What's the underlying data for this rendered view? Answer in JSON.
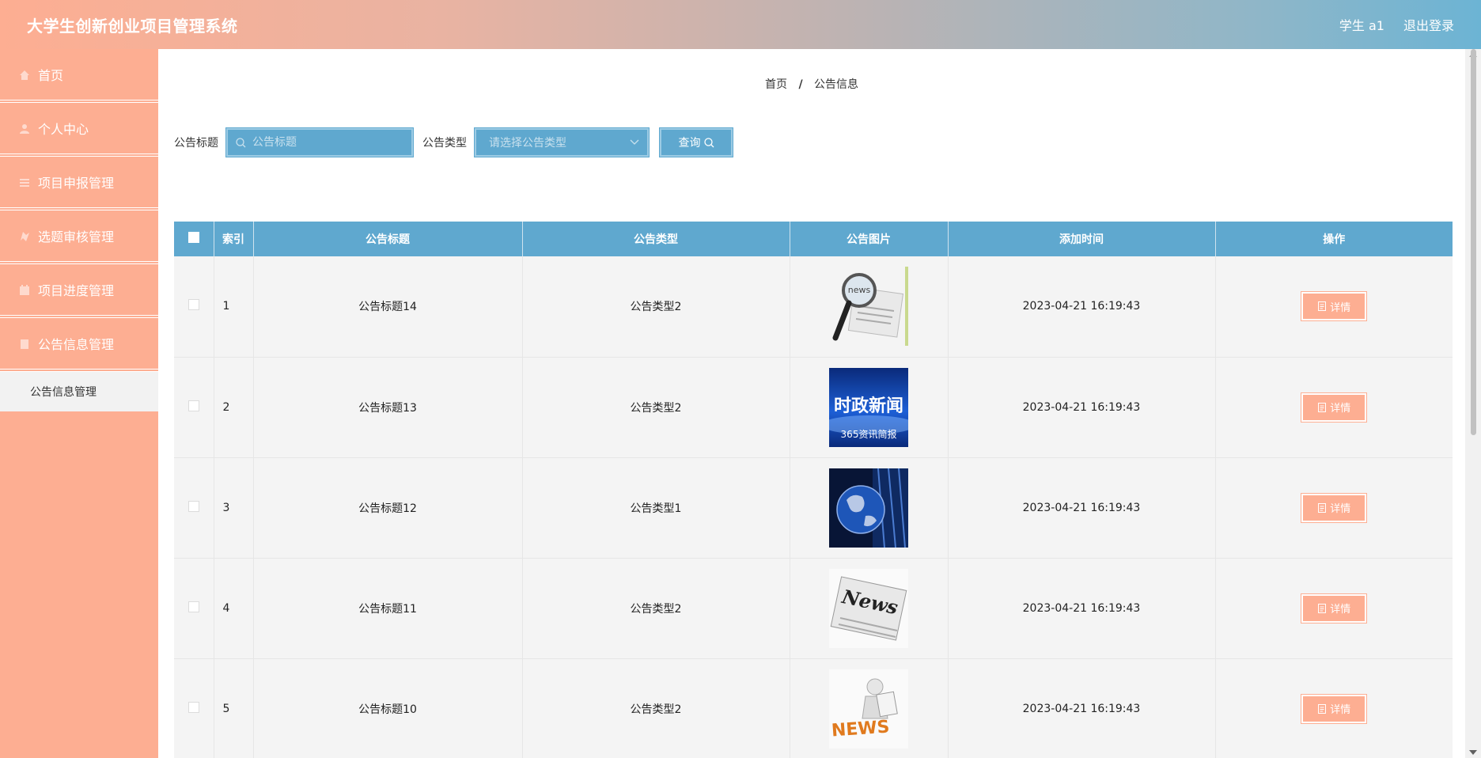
{
  "header": {
    "title": "大学生创新创业项目管理系统",
    "user": "学生 a1",
    "logout": "退出登录"
  },
  "sidebar": {
    "items": [
      {
        "label": "首页",
        "icon": "home-icon"
      },
      {
        "label": "个人中心",
        "icon": "user-icon"
      },
      {
        "label": "项目申报管理",
        "icon": "menu-icon"
      },
      {
        "label": "选题审核管理",
        "icon": "audit-icon"
      },
      {
        "label": "项目进度管理",
        "icon": "calendar-icon"
      },
      {
        "label": "公告信息管理",
        "icon": "notice-icon"
      }
    ],
    "submenu": {
      "label": "公告信息管理"
    }
  },
  "breadcrumb": {
    "home": "首页",
    "sep": "/",
    "current": "公告信息"
  },
  "search": {
    "title_label": "公告标题",
    "title_placeholder": "公告标题",
    "type_label": "公告类型",
    "type_placeholder": "请选择公告类型",
    "button": "查询"
  },
  "table": {
    "columns": [
      "索引",
      "公告标题",
      "公告类型",
      "公告图片",
      "添加时间",
      "操作"
    ],
    "rows": [
      {
        "index": "1",
        "title": "公告标题14",
        "type": "公告类型2",
        "image": "news-magnifier-image",
        "time": "2023-04-21 16:19:43",
        "action": "详情"
      },
      {
        "index": "2",
        "title": "公告标题13",
        "type": "公告类型2",
        "image": "political-news-image",
        "image_text": "时政新闻",
        "image_subtext": "365资讯简报",
        "time": "2023-04-21 16:19:43",
        "action": "详情"
      },
      {
        "index": "3",
        "title": "公告标题12",
        "type": "公告类型1",
        "image": "globe-news-image",
        "time": "2023-04-21 16:19:43",
        "action": "详情"
      },
      {
        "index": "4",
        "title": "公告标题11",
        "type": "公告类型2",
        "image": "newspaper-image",
        "image_text": "News",
        "time": "2023-04-21 16:19:43",
        "action": "详情"
      },
      {
        "index": "5",
        "title": "公告标题10",
        "type": "公告类型2",
        "image": "figure-news-image",
        "image_text": "NEWS",
        "time": "2023-04-21 16:19:43",
        "action": "详情"
      }
    ]
  },
  "colors": {
    "primary": "#5fa8cf",
    "accent": "#fdae92"
  }
}
